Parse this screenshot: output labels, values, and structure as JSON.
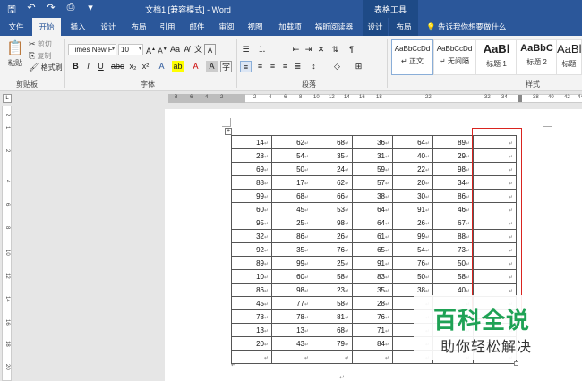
{
  "app": {
    "title": "文档1 [兼容模式] - Word",
    "context_group": "表格工具"
  },
  "tabs": [
    "文件",
    "开始",
    "插入",
    "设计",
    "布局",
    "引用",
    "邮件",
    "审阅",
    "视图",
    "加载项",
    "福昕阅读器",
    "设计",
    "布局"
  ],
  "active_tab_index": 1,
  "tellme": "告诉我你想要做什么",
  "clipboard": {
    "paste": "粘贴",
    "cut": "剪切",
    "copy": "复制",
    "format_painter": "格式刷",
    "label": "剪贴板"
  },
  "font": {
    "name": "Times New F",
    "size": "10",
    "label": "字体"
  },
  "paragraph": {
    "label": "段落"
  },
  "styles": {
    "label": "样式",
    "items": [
      {
        "sample": "AaBbCcDd",
        "name": "↵ 正文"
      },
      {
        "sample": "AaBbCcDd",
        "name": "↵ 无间隔"
      },
      {
        "sample": "AaBl",
        "name": "标题 1"
      },
      {
        "sample": "AaBbC",
        "name": "标题 2"
      },
      {
        "sample": "AaBl",
        "name": "标题"
      }
    ]
  },
  "ruler": {
    "numbers": [
      "8",
      "6",
      "4",
      "2",
      "2",
      "4",
      "6",
      "8",
      "10",
      "12",
      "14",
      "16",
      "18",
      "22",
      "32",
      "34",
      "38",
      "40",
      "42",
      "44"
    ]
  },
  "vruler": {
    "numbers": [
      "2",
      "1",
      "2",
      "4",
      "6",
      "8",
      "10",
      "12",
      "14",
      "16",
      "18",
      "20"
    ]
  },
  "table": {
    "rows": [
      [
        "14",
        "62",
        "68",
        "36",
        "64",
        "89",
        ""
      ],
      [
        "28",
        "54",
        "35",
        "31",
        "40",
        "29",
        ""
      ],
      [
        "69",
        "50",
        "24",
        "59",
        "22",
        "98",
        ""
      ],
      [
        "88",
        "17",
        "62",
        "57",
        "20",
        "34",
        ""
      ],
      [
        "99",
        "68",
        "66",
        "38",
        "30",
        "86",
        ""
      ],
      [
        "60",
        "45",
        "53",
        "64",
        "91",
        "46",
        ""
      ],
      [
        "95",
        "25",
        "98",
        "64",
        "26",
        "67",
        ""
      ],
      [
        "32",
        "86",
        "26",
        "61",
        "99",
        "88",
        ""
      ],
      [
        "92",
        "35",
        "76",
        "65",
        "54",
        "73",
        ""
      ],
      [
        "89",
        "99",
        "25",
        "91",
        "76",
        "50",
        ""
      ],
      [
        "10",
        "60",
        "58",
        "83",
        "50",
        "58",
        ""
      ],
      [
        "86",
        "98",
        "23",
        "35",
        "38",
        "40",
        ""
      ],
      [
        "45",
        "77",
        "58",
        "28",
        "",
        "",
        ""
      ],
      [
        "78",
        "78",
        "81",
        "76",
        "",
        "",
        ""
      ],
      [
        "13",
        "13",
        "68",
        "71",
        "",
        "",
        ""
      ],
      [
        "20",
        "43",
        "79",
        "84",
        "",
        "",
        ""
      ],
      [
        "",
        "",
        "",
        "",
        "",
        "",
        ""
      ]
    ]
  },
  "watermark": {
    "title": "百科全说",
    "subtitle": "助你轻松解决"
  },
  "colors": {
    "brand": "#2b579a",
    "selection": "#d9241f",
    "watermark": "#1fa255"
  }
}
